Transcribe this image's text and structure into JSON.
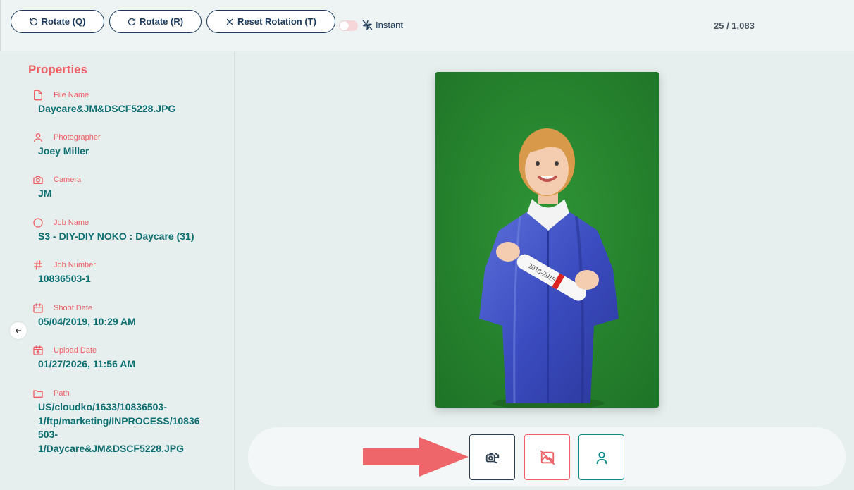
{
  "toolbar": {
    "rotate_q_label": "Rotate (Q)",
    "rotate_r_label": "Rotate (R)",
    "reset_label": "Reset Rotation (T)",
    "instant_label": "Instant",
    "instant_enabled": false,
    "counter": "25 / 1,083"
  },
  "properties": {
    "title": "Properties",
    "items": [
      {
        "icon": "file-icon",
        "label": "File Name",
        "value": "Daycare&JM&DSCF5228.JPG"
      },
      {
        "icon": "user-icon",
        "label": "Photographer",
        "value": "Joey Miller"
      },
      {
        "icon": "camera-icon",
        "label": "Camera",
        "value": "JM"
      },
      {
        "icon": "circle-icon",
        "label": "Job Name",
        "value": "S3 - DIY-DIY NOKO : Daycare (31)"
      },
      {
        "icon": "hash-icon",
        "label": "Job Number",
        "value": "10836503-1"
      },
      {
        "icon": "calendar-icon",
        "label": "Shoot Date",
        "value": "05/04/2019, 10:29 AM"
      },
      {
        "icon": "calendar-upload-icon",
        "label": "Upload Date",
        "value": "01/27/2026, 11:56 AM"
      },
      {
        "icon": "folder-icon",
        "label": "Path",
        "value_lines": [
          "US/cloudko/1633/10836503-",
          "1/ftp/marketing/INPROCESS/10836",
          "503-",
          "1/Daycare&JM&DSCF5228.JPG"
        ]
      }
    ]
  },
  "photo": {
    "background_color": "#2d8a33",
    "diploma_text": "2018-2019"
  },
  "actions": [
    {
      "icon": "rotate-camera-icon",
      "border": "#2c3e50"
    },
    {
      "icon": "image-off-icon",
      "border": "#ef5f65"
    },
    {
      "icon": "person-icon",
      "border": "#0e8a8c"
    }
  ],
  "colors": {
    "accent_red": "#ef5f65",
    "accent_teal": "#0e6f70",
    "navy": "#1b3a5c",
    "annotation_arrow": "#ef666a"
  }
}
